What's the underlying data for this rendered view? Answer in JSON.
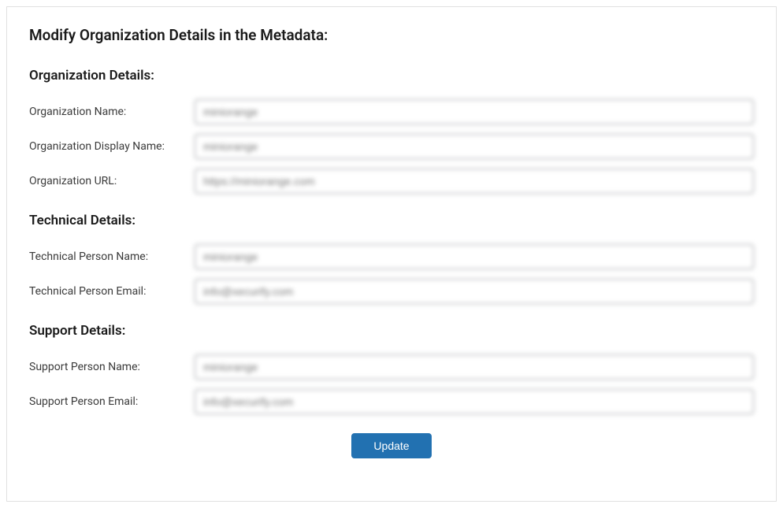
{
  "page_title": "Modify Organization Details in the Metadata:",
  "sections": {
    "organization": {
      "title": "Organization Details:",
      "fields": {
        "name": {
          "label": "Organization Name:",
          "value": "miniorange"
        },
        "display_name": {
          "label": "Organization Display Name:",
          "value": "miniorange"
        },
        "url": {
          "label": "Organization URL:",
          "value": "https://miniorange.com"
        }
      }
    },
    "technical": {
      "title": "Technical Details:",
      "fields": {
        "name": {
          "label": "Technical Person Name:",
          "value": "miniorange"
        },
        "email": {
          "label": "Technical Person Email:",
          "value": "info@xecurify.com"
        }
      }
    },
    "support": {
      "title": "Support Details:",
      "fields": {
        "name": {
          "label": "Support Person Name:",
          "value": "miniorange"
        },
        "email": {
          "label": "Support Person Email:",
          "value": "info@xecurify.com"
        }
      }
    }
  },
  "actions": {
    "update_label": "Update"
  }
}
